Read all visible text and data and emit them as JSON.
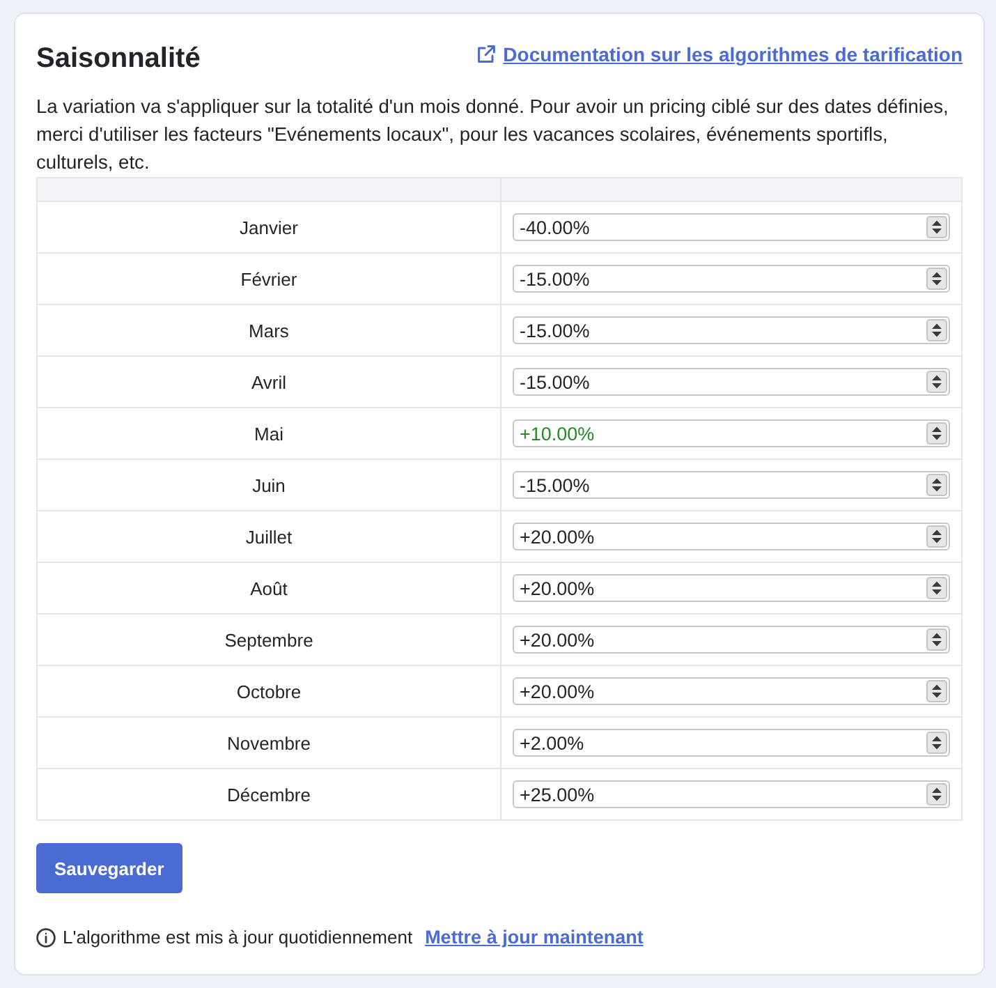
{
  "header": {
    "title": "Saisonnalité",
    "doc_link": "Documentation sur les algorithmes de tarification"
  },
  "description": "La variation va s'appliquer sur la totalité d'un mois donné. Pour avoir un pricing ciblé sur des dates définies, merci d'utiliser les facteurs \"Evénements locaux\", pour les vacances scolaires, événements sportifls, culturels, etc.",
  "table": {
    "rows": [
      {
        "month": "Janvier",
        "value": "-40.00%",
        "color": "#212529"
      },
      {
        "month": "Février",
        "value": "-15.00%",
        "color": "#212529"
      },
      {
        "month": "Mars",
        "value": "-15.00%",
        "color": "#212529"
      },
      {
        "month": "Avril",
        "value": "-15.00%",
        "color": "#212529"
      },
      {
        "month": "Mai",
        "value": "+10.00%",
        "color": "#228b22"
      },
      {
        "month": "Juin",
        "value": "-15.00%",
        "color": "#212529"
      },
      {
        "month": "Juillet",
        "value": "+20.00%",
        "color": "#212529"
      },
      {
        "month": "Août",
        "value": "+20.00%",
        "color": "#212529"
      },
      {
        "month": "Septembre",
        "value": "+20.00%",
        "color": "#212529"
      },
      {
        "month": "Octobre",
        "value": "+20.00%",
        "color": "#212529"
      },
      {
        "month": "Novembre",
        "value": "+2.00%",
        "color": "#212529"
      },
      {
        "month": "Décembre",
        "value": "+25.00%",
        "color": "#212529"
      }
    ]
  },
  "save_button": "Sauvegarder",
  "footer": {
    "note": "L'algorithme est mis à jour quotidiennement",
    "link": "Mettre à jour maintenant"
  }
}
